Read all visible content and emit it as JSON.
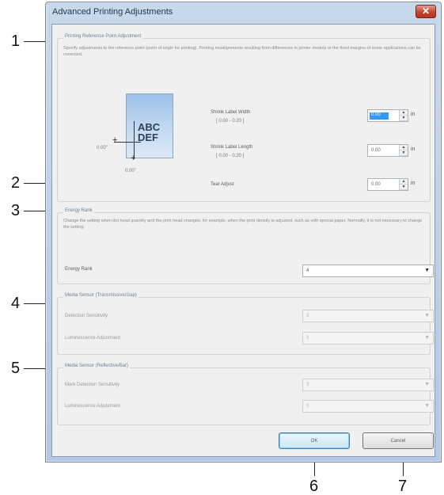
{
  "callouts": [
    "1",
    "2",
    "3",
    "4",
    "5",
    "6",
    "7"
  ],
  "window": {
    "title": "Advanced Printing Adjustments",
    "close_glyph": "✕"
  },
  "print_ref": {
    "group_title": "Printing Reference Point Adjustment",
    "description": "Specify adjustments to the reference point (point of origin for printing). Printing misalignments resulting from differences in printer models or the fixed margins of some applications can be corrected.",
    "preview_text_line1": "ABC",
    "preview_text_line2": "DEF",
    "preview_offset_h": "0.00\"",
    "preview_offset_v": "0.00\"",
    "horizontal_label": "Shrink Label Width",
    "horizontal_range": "[ 0.00 - 0.20 ]",
    "horizontal_value": "0.00",
    "vertical_label": "Shrink Label Length",
    "vertical_range": "[ 0.00 - 0.20 ]",
    "vertical_value": "0.00",
    "feed_label": "Tear Adjust",
    "feed_value": "0.00",
    "unit": "in"
  },
  "energy": {
    "group_title": "Energy Rank",
    "description": "Change the setting when dot head quantity and the print head changes, for example, when the print density is adjusted, such as with special paper. Normally, it is not necessary to change the setting.",
    "label": "Energy Rank",
    "value": "4"
  },
  "sensor_transmissive": {
    "group_title": "Media Sensor (Transmissive/Gap)",
    "detection_label": "Detection Sensitivity",
    "detection_value": "3",
    "luminescence_label": "Luminescence Adjustment",
    "luminescence_value": "3"
  },
  "sensor_reflective": {
    "group_title": "Media Sensor (Reflective/Bar)",
    "detection_label": "Mark Detection Sensitivity",
    "detection_value": "3",
    "luminescence_label": "Luminescence Adjustment",
    "luminescence_value": "3"
  },
  "buttons": {
    "ok": "OK",
    "cancel": "Cancel"
  }
}
